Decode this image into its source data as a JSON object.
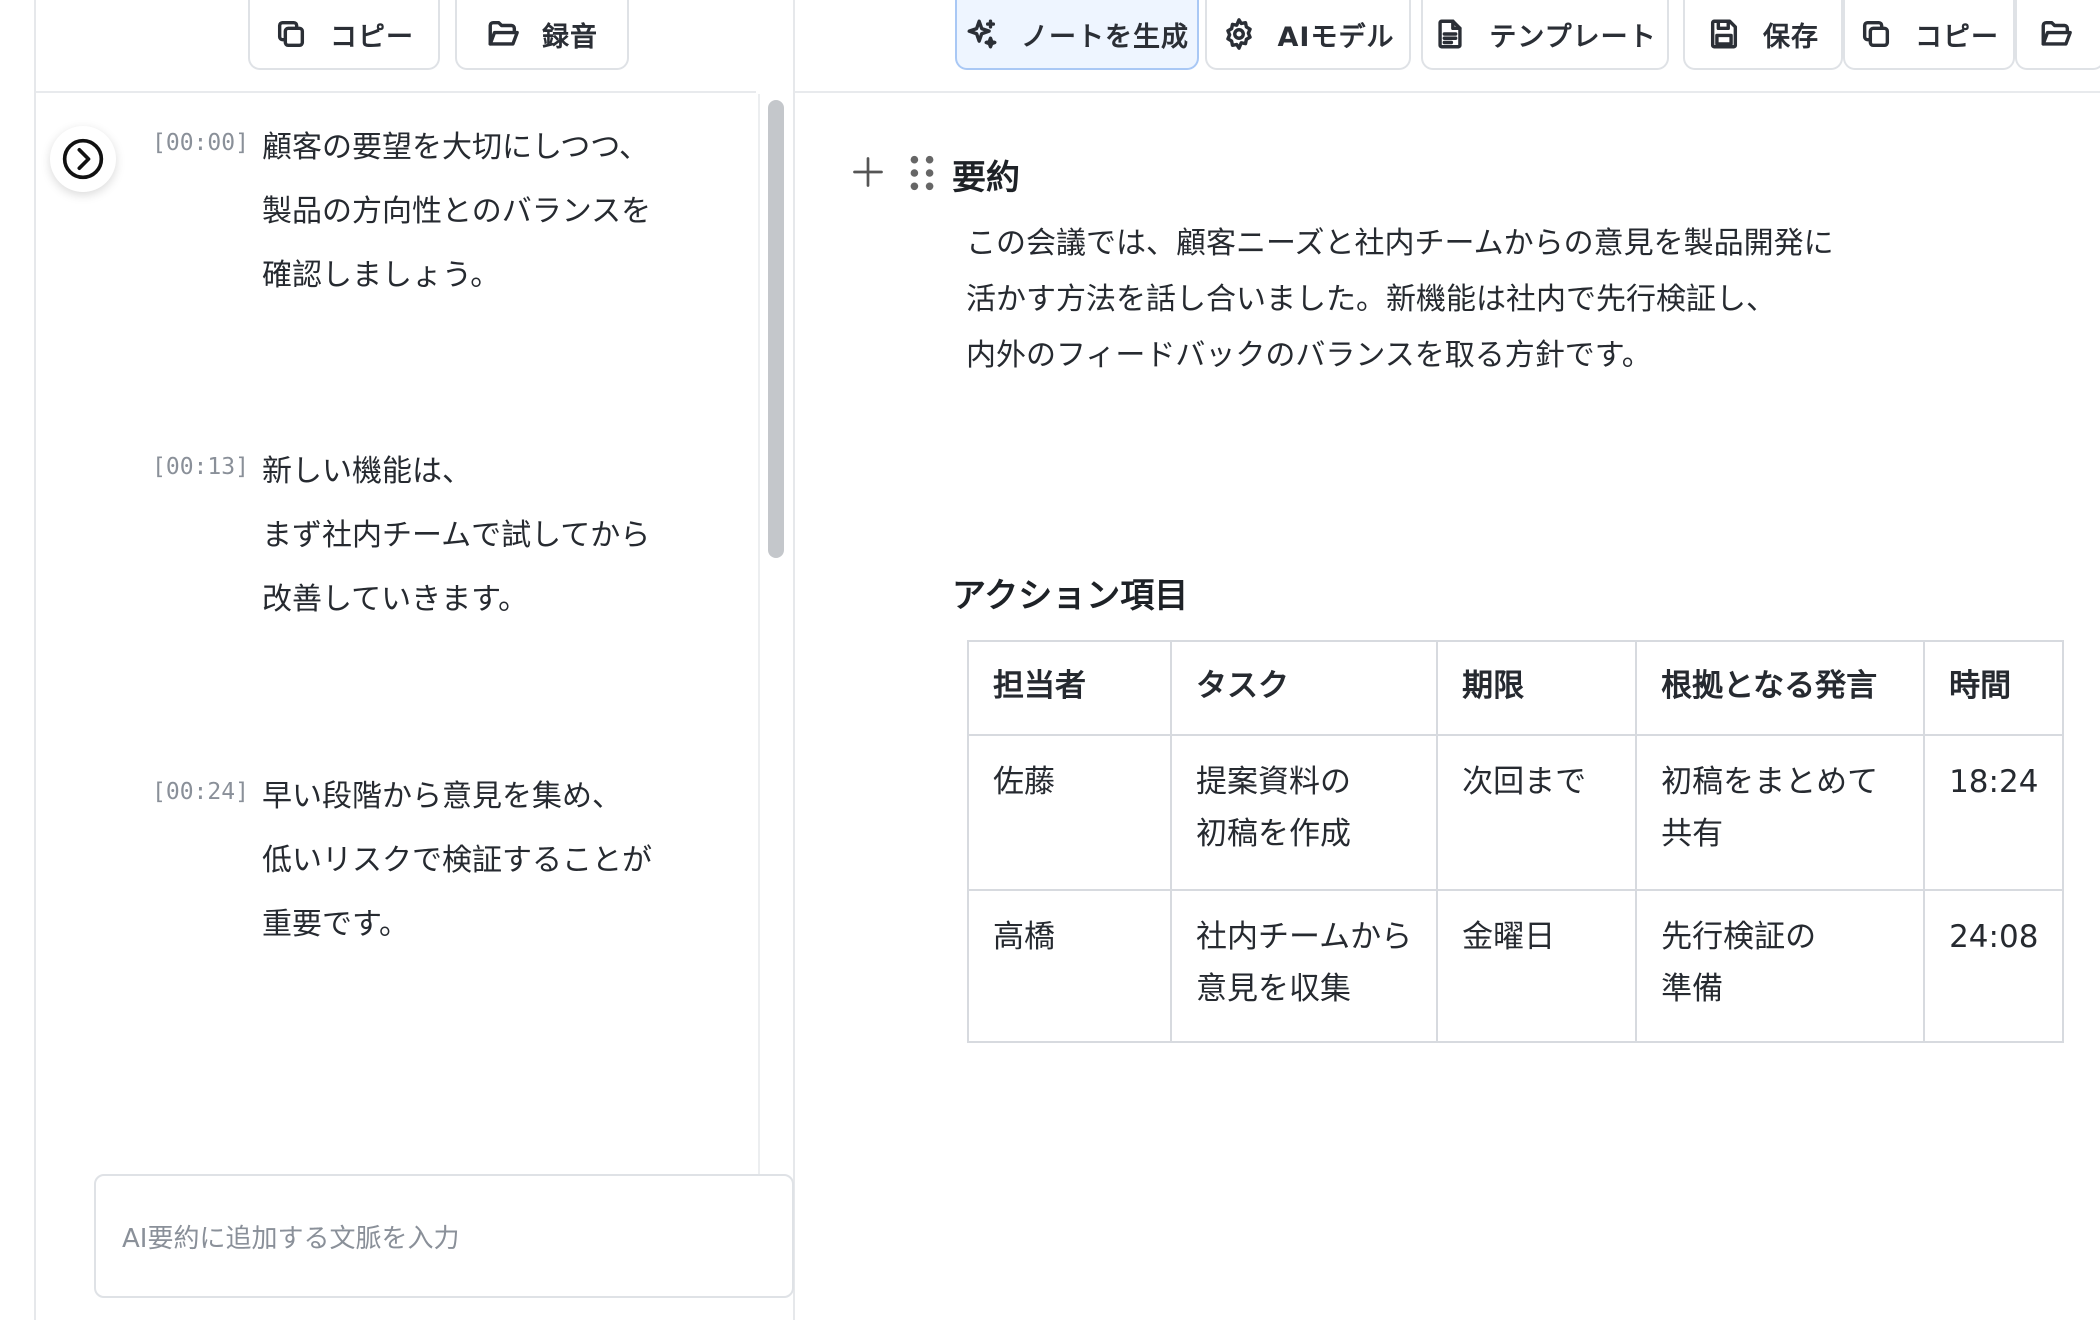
{
  "left_toolbar": {
    "copy_label": "コピー",
    "record_label": "録音"
  },
  "right_toolbar": {
    "generate_label": "ノートを生成",
    "ai_model_label": "AIモデル",
    "template_label": "テンプレート",
    "save_label": "保存",
    "copy_label": "コピー"
  },
  "transcript": {
    "segments": [
      {
        "time": "[00:00]",
        "lines": [
          "顧客の要望を大切にしつつ、",
          "製品の方向性とのバランスを",
          "確認しましょう。"
        ]
      },
      {
        "time": "[00:13]",
        "lines": [
          "新しい機能は、",
          "まず社内チームで試してから",
          "改善していきます。"
        ]
      },
      {
        "time": "[00:24]",
        "lines": [
          "早い段階から意見を集め、",
          "低いリスクで検証することが",
          "重要です。"
        ]
      }
    ],
    "context_placeholder": "AI要約に追加する文脈を入力"
  },
  "note": {
    "summary_heading": "要約",
    "summary_lines": [
      "この会議では、顧客ニーズと社内チームからの意見を製品開発に",
      "活かす方法を話し合いました。新機能は社内で先行検証し、",
      "内外のフィードバックのバランスを取る方針です。"
    ],
    "actions_heading": "アクション項目",
    "table": {
      "headers": [
        "担当者",
        "タスク",
        "期限",
        "根拠となる発言",
        "時間"
      ],
      "rows": [
        {
          "owner": "佐藤",
          "task": [
            "提案資料の",
            "初稿を作成"
          ],
          "due": "次回まで",
          "evidence": [
            "初稿をまとめて",
            "共有"
          ],
          "time": "18:24"
        },
        {
          "owner": "高橋",
          "task": [
            "社内チームから",
            "意見を収集"
          ],
          "due": "金曜日",
          "evidence": [
            "先行検証の",
            "準備"
          ],
          "time": "24:08"
        }
      ]
    }
  }
}
